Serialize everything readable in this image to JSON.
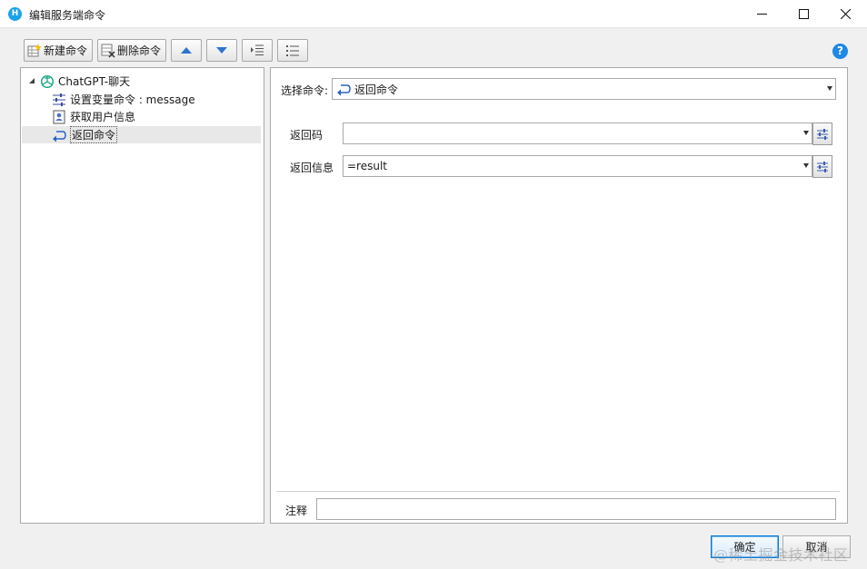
{
  "window": {
    "title": "编辑服务端命令",
    "app_icon_letter": "H"
  },
  "toolbar": {
    "new_label": "新建命令",
    "delete_label": "删除命令"
  },
  "help": {
    "glyph": "?"
  },
  "tree": {
    "root_label": "ChatGPT-聊天",
    "items": [
      {
        "label": "设置变量命令 : message",
        "icon": "sliders-icon"
      },
      {
        "label": "获取用户信息",
        "icon": "user-card-icon"
      },
      {
        "label": "返回命令",
        "icon": "return-arrow-icon",
        "selected": true
      }
    ]
  },
  "command": {
    "select_label": "选择命令:",
    "selected_value": "返回命令"
  },
  "fields": [
    {
      "label": "返回码",
      "value": ""
    },
    {
      "label": "返回信息",
      "value": "=result"
    }
  ],
  "note": {
    "label": "注释",
    "value": ""
  },
  "buttons": {
    "ok": "确定",
    "cancel": "取消"
  },
  "watermark": "@稀土掘金技术社区",
  "colors": {
    "accent": "#1e88e5",
    "return_icon": "#2a62c9",
    "chatgpt_icon": "#10a37f"
  }
}
